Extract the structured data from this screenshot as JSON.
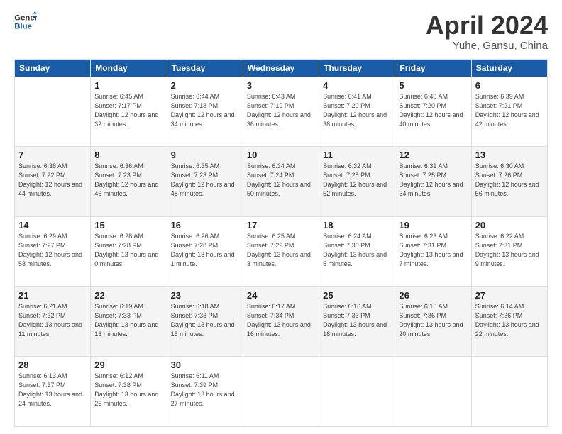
{
  "logo": {
    "line1": "General",
    "line2": "Blue"
  },
  "title": "April 2024",
  "subtitle": "Yuhe, Gansu, China",
  "weekdays": [
    "Sunday",
    "Monday",
    "Tuesday",
    "Wednesday",
    "Thursday",
    "Friday",
    "Saturday"
  ],
  "weeks": [
    [
      {
        "day": null
      },
      {
        "day": "1",
        "sunrise": "6:45 AM",
        "sunset": "7:17 PM",
        "daylight": "12 hours and 32 minutes."
      },
      {
        "day": "2",
        "sunrise": "6:44 AM",
        "sunset": "7:18 PM",
        "daylight": "12 hours and 34 minutes."
      },
      {
        "day": "3",
        "sunrise": "6:43 AM",
        "sunset": "7:19 PM",
        "daylight": "12 hours and 36 minutes."
      },
      {
        "day": "4",
        "sunrise": "6:41 AM",
        "sunset": "7:20 PM",
        "daylight": "12 hours and 38 minutes."
      },
      {
        "day": "5",
        "sunrise": "6:40 AM",
        "sunset": "7:20 PM",
        "daylight": "12 hours and 40 minutes."
      },
      {
        "day": "6",
        "sunrise": "6:39 AM",
        "sunset": "7:21 PM",
        "daylight": "12 hours and 42 minutes."
      }
    ],
    [
      {
        "day": "7",
        "sunrise": "6:38 AM",
        "sunset": "7:22 PM",
        "daylight": "12 hours and 44 minutes."
      },
      {
        "day": "8",
        "sunrise": "6:36 AM",
        "sunset": "7:23 PM",
        "daylight": "12 hours and 46 minutes."
      },
      {
        "day": "9",
        "sunrise": "6:35 AM",
        "sunset": "7:23 PM",
        "daylight": "12 hours and 48 minutes."
      },
      {
        "day": "10",
        "sunrise": "6:34 AM",
        "sunset": "7:24 PM",
        "daylight": "12 hours and 50 minutes."
      },
      {
        "day": "11",
        "sunrise": "6:32 AM",
        "sunset": "7:25 PM",
        "daylight": "12 hours and 52 minutes."
      },
      {
        "day": "12",
        "sunrise": "6:31 AM",
        "sunset": "7:25 PM",
        "daylight": "12 hours and 54 minutes."
      },
      {
        "day": "13",
        "sunrise": "6:30 AM",
        "sunset": "7:26 PM",
        "daylight": "12 hours and 56 minutes."
      }
    ],
    [
      {
        "day": "14",
        "sunrise": "6:29 AM",
        "sunset": "7:27 PM",
        "daylight": "12 hours and 58 minutes."
      },
      {
        "day": "15",
        "sunrise": "6:28 AM",
        "sunset": "7:28 PM",
        "daylight": "13 hours and 0 minutes."
      },
      {
        "day": "16",
        "sunrise": "6:26 AM",
        "sunset": "7:28 PM",
        "daylight": "13 hours and 1 minute."
      },
      {
        "day": "17",
        "sunrise": "6:25 AM",
        "sunset": "7:29 PM",
        "daylight": "13 hours and 3 minutes."
      },
      {
        "day": "18",
        "sunrise": "6:24 AM",
        "sunset": "7:30 PM",
        "daylight": "13 hours and 5 minutes."
      },
      {
        "day": "19",
        "sunrise": "6:23 AM",
        "sunset": "7:31 PM",
        "daylight": "13 hours and 7 minutes."
      },
      {
        "day": "20",
        "sunrise": "6:22 AM",
        "sunset": "7:31 PM",
        "daylight": "13 hours and 9 minutes."
      }
    ],
    [
      {
        "day": "21",
        "sunrise": "6:21 AM",
        "sunset": "7:32 PM",
        "daylight": "13 hours and 11 minutes."
      },
      {
        "day": "22",
        "sunrise": "6:19 AM",
        "sunset": "7:33 PM",
        "daylight": "13 hours and 13 minutes."
      },
      {
        "day": "23",
        "sunrise": "6:18 AM",
        "sunset": "7:33 PM",
        "daylight": "13 hours and 15 minutes."
      },
      {
        "day": "24",
        "sunrise": "6:17 AM",
        "sunset": "7:34 PM",
        "daylight": "13 hours and 16 minutes."
      },
      {
        "day": "25",
        "sunrise": "6:16 AM",
        "sunset": "7:35 PM",
        "daylight": "13 hours and 18 minutes."
      },
      {
        "day": "26",
        "sunrise": "6:15 AM",
        "sunset": "7:36 PM",
        "daylight": "13 hours and 20 minutes."
      },
      {
        "day": "27",
        "sunrise": "6:14 AM",
        "sunset": "7:36 PM",
        "daylight": "13 hours and 22 minutes."
      }
    ],
    [
      {
        "day": "28",
        "sunrise": "6:13 AM",
        "sunset": "7:37 PM",
        "daylight": "13 hours and 24 minutes."
      },
      {
        "day": "29",
        "sunrise": "6:12 AM",
        "sunset": "7:38 PM",
        "daylight": "13 hours and 25 minutes."
      },
      {
        "day": "30",
        "sunrise": "6:11 AM",
        "sunset": "7:39 PM",
        "daylight": "13 hours and 27 minutes."
      },
      {
        "day": null
      },
      {
        "day": null
      },
      {
        "day": null
      },
      {
        "day": null
      }
    ]
  ]
}
